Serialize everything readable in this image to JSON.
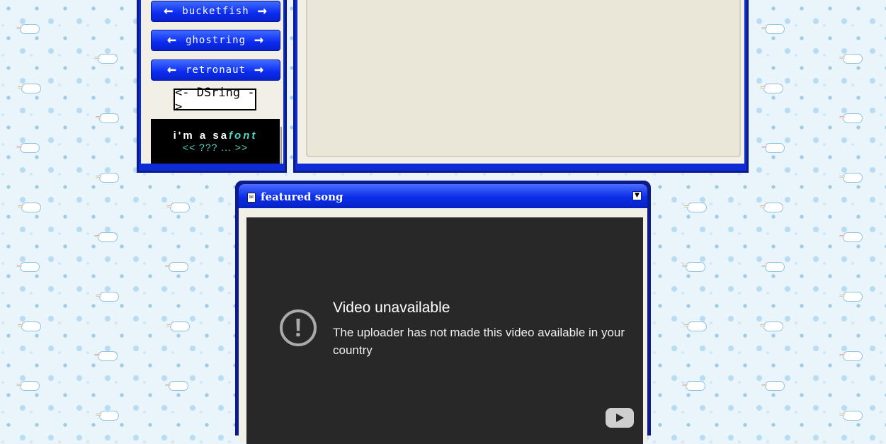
{
  "sidebar": {
    "webrings": [
      {
        "name": "bucketfish",
        "prev_icon": "arrow-left-icon",
        "next_icon": "arrow-right-icon"
      },
      {
        "name": "ghostring",
        "prev_icon": "arrow-left-icon",
        "next_icon": "arrow-right-icon"
      },
      {
        "name": "retronaut",
        "prev_icon": "arrow-left-icon",
        "next_icon": "arrow-right-icon"
      }
    ],
    "dsring_label": "<- DSring ->",
    "safont": {
      "prefix": "i'm a sa",
      "highlight": "font",
      "nav": "<< ??? ... >>"
    }
  },
  "featured": {
    "title": "featured song",
    "title_icon": "document-icon",
    "collapse_icon": "chevron-down-icon",
    "video": {
      "icon": "alert-circle-icon",
      "heading": "Video unavailable",
      "message": "The uploader has not made this video available in your country",
      "logo_icon": "youtube-play-icon"
    }
  },
  "colors": {
    "window_blue": "#0d2bd6",
    "window_border": "#0d1a8a",
    "panel_bg": "#f2f0e6",
    "accent_teal": "#4fd6c5",
    "video_bg": "#282828"
  }
}
